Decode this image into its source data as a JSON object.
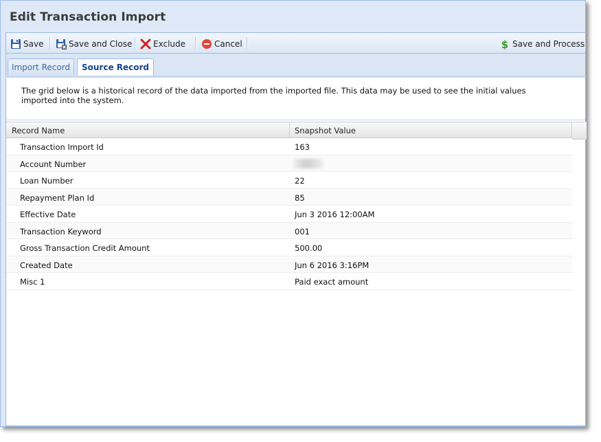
{
  "window": {
    "title": "Edit Transaction Import"
  },
  "toolbar": {
    "save_label": "Save",
    "save_close_label": "Save and Close",
    "exclude_label": "Exclude",
    "cancel_label": "Cancel",
    "save_process_label": "Save and Process"
  },
  "tabs": [
    {
      "label": "Import Record",
      "active": false
    },
    {
      "label": "Source Record",
      "active": true
    }
  ],
  "description": "The grid below is a historical record of the data imported from the imported file. This data may be used to see the initial values imported into the system.",
  "grid": {
    "headers": {
      "name": "Record Name",
      "value": "Snapshot Value"
    },
    "rows": [
      {
        "name": "Transaction Import Id",
        "value": "163"
      },
      {
        "name": "Account Number",
        "value": ""
      },
      {
        "name": "Loan Number",
        "value": "22"
      },
      {
        "name": "Repayment Plan Id",
        "value": "85"
      },
      {
        "name": "Effective Date",
        "value": "Jun 3 2016 12:00AM"
      },
      {
        "name": "Transaction Keyword",
        "value": "001"
      },
      {
        "name": "Gross Transaction Credit Amount",
        "value": "500.00"
      },
      {
        "name": "Created Date",
        "value": "Jun 6 2016 3:16PM"
      },
      {
        "name": "Misc 1",
        "value": "Paid exact amount"
      }
    ]
  },
  "colors": {
    "window_bg": "#dfe8f6",
    "border": "#99bbe8",
    "active_tab_text": "#15428b",
    "inactive_tab_text": "#416aa3"
  }
}
